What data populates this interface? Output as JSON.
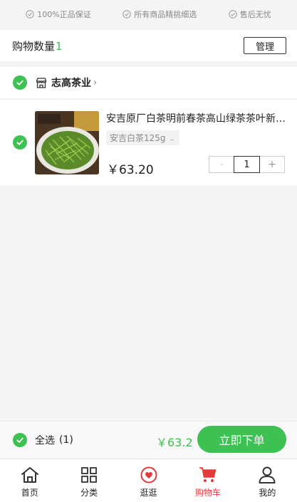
{
  "guarantees": [
    {
      "label": "100%正品保证"
    },
    {
      "label": "所有商品精挑细选"
    },
    {
      "label": "售后无忧"
    }
  ],
  "cart_header": {
    "count_label": "购物数量",
    "count_value": "1",
    "manage_label": "管理"
  },
  "store": {
    "name": "志高茶业",
    "chevron": "›"
  },
  "item": {
    "title": "安吉原厂白茶明前春茶高山绿茶茶叶新茶散装",
    "sku": "安吉白茶125g",
    "price": "￥63.20",
    "quantity": "1",
    "minus": "-",
    "plus": "+"
  },
  "checkout": {
    "select_all_label": "全选",
    "select_count": "(1)",
    "total": "￥63.2",
    "submit_label": "立即下单"
  },
  "tabbar": {
    "tabs": [
      {
        "label": "首页",
        "icon": "home-icon"
      },
      {
        "label": "分类",
        "icon": "grid-icon"
      },
      {
        "label": "逛逛",
        "icon": "heart-chat-icon"
      },
      {
        "label": "购物车",
        "icon": "cart-icon",
        "active": true
      },
      {
        "label": "我的",
        "icon": "user-icon"
      }
    ]
  },
  "colors": {
    "accent_green": "#3dc152",
    "active_red": "#e5383b"
  }
}
